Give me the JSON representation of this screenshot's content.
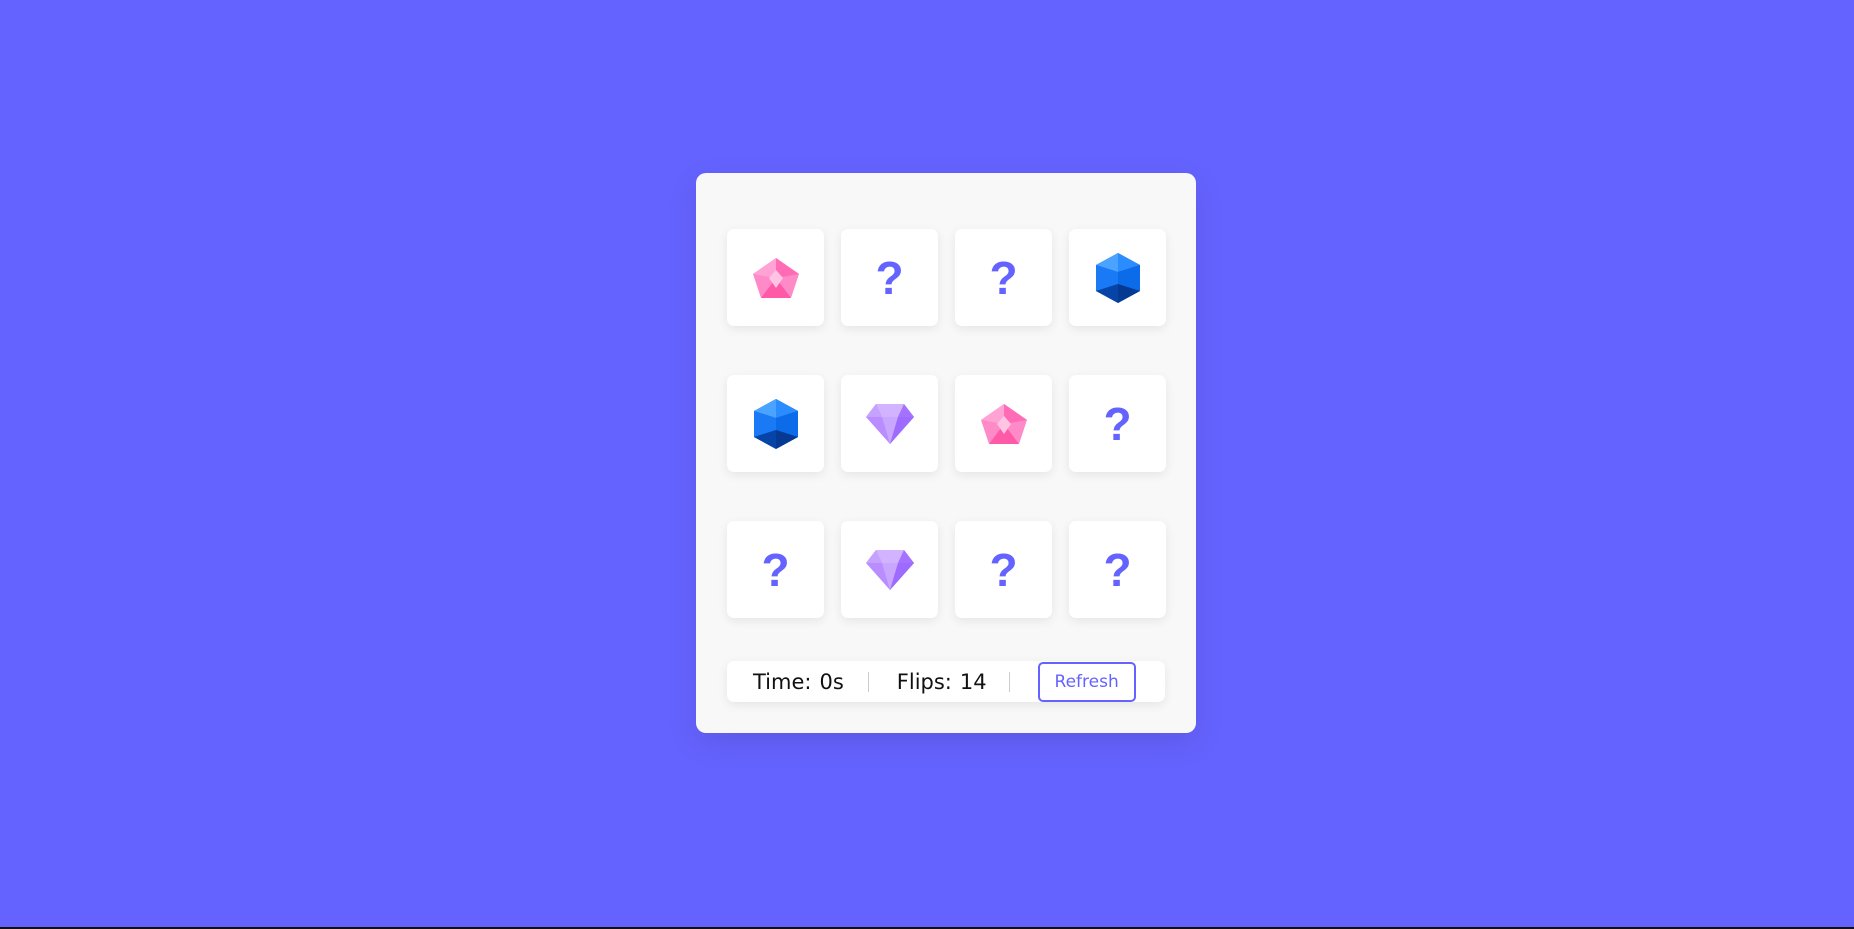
{
  "board": {
    "cards": [
      {
        "state": "revealed",
        "icon": "pink-gem-icon"
      },
      {
        "state": "hidden",
        "label": "?"
      },
      {
        "state": "hidden",
        "label": "?"
      },
      {
        "state": "revealed",
        "icon": "blue-gem-icon"
      },
      {
        "state": "revealed",
        "icon": "blue-gem-icon"
      },
      {
        "state": "revealed",
        "icon": "purple-diamond-icon"
      },
      {
        "state": "revealed",
        "icon": "pink-gem-icon"
      },
      {
        "state": "hidden",
        "label": "?"
      },
      {
        "state": "hidden",
        "label": "?"
      },
      {
        "state": "revealed",
        "icon": "purple-diamond-icon"
      },
      {
        "state": "hidden",
        "label": "?"
      },
      {
        "state": "hidden",
        "label": "?"
      }
    ]
  },
  "details": {
    "time_label": "Time:",
    "time_value": "0s",
    "flips_label": "Flips:",
    "flips_value": "14",
    "refresh_label": "Refresh"
  },
  "colors": {
    "background": "#6563ff",
    "accent": "#6563ff",
    "panel": "#f8f8f8"
  }
}
